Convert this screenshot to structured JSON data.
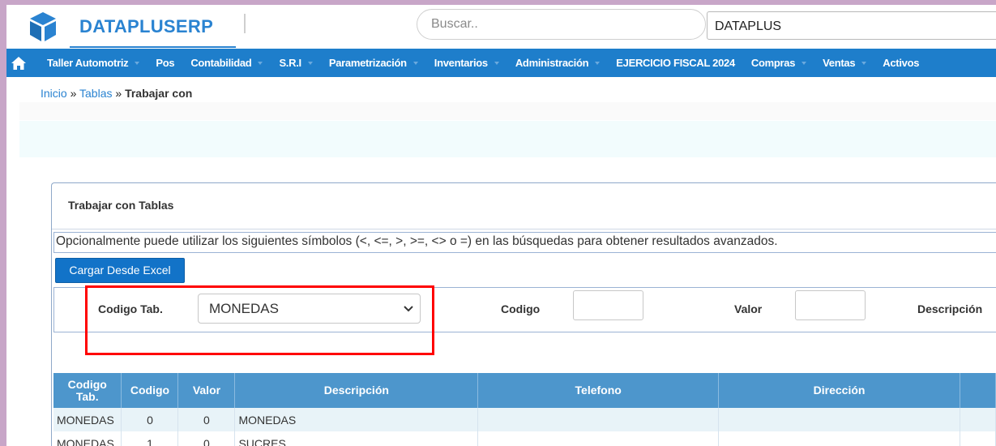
{
  "header": {
    "brand": "DATAPLUSERP",
    "search_placeholder": "Buscar..",
    "company": "DATAPLUS"
  },
  "nav": {
    "items": [
      {
        "label": "Taller Automotriz"
      },
      {
        "label": "Pos"
      },
      {
        "label": "Contabilidad"
      },
      {
        "label": "S.R.I"
      },
      {
        "label": "Parametrización"
      },
      {
        "label": "Inventarios"
      },
      {
        "label": "Administración"
      },
      {
        "label": "EJERCICIO FISCAL 2024"
      },
      {
        "label": "Compras"
      },
      {
        "label": "Ventas"
      },
      {
        "label": "Activos"
      }
    ]
  },
  "breadcrumb": {
    "home": "Inicio",
    "sep1": "»",
    "tables": "Tablas",
    "sep2": "»",
    "current": "Trabajar con"
  },
  "panel": {
    "title": "Trabajar con Tablas",
    "hint": "Opcionalmente puede utilizar los siguientes símbolos (<, <=, >, >=, <> o =) en las búsquedas para obtener resultados avanzados.",
    "excel_button": "Cargar Desde Excel"
  },
  "filters": {
    "codigo_tab_label": "Codigo Tab.",
    "codigo_tab_value": "MONEDAS",
    "codigo_label": "Codigo",
    "valor_label": "Valor",
    "descripcion_label": "Descripción"
  },
  "table": {
    "headers": {
      "codigo_tab": "Codigo Tab.",
      "codigo": "Codigo",
      "valor": "Valor",
      "descripcion": "Descripción",
      "telefono": "Telefono",
      "direccion": "Dirección"
    },
    "rows": [
      {
        "codigo_tab": "MONEDAS",
        "codigo": "0",
        "valor": "0",
        "descripcion": "MONEDAS",
        "telefono": "",
        "direccion": ""
      },
      {
        "codigo_tab": "MONEDAS",
        "codigo": "1",
        "valor": "0",
        "descripcion": "SUCRES",
        "telefono": "",
        "direccion": ""
      }
    ]
  },
  "colors": {
    "brand": "#2a83d1",
    "nav": "#1e7ecb",
    "table_header": "#4d96cc",
    "highlight": "#ff0000"
  }
}
